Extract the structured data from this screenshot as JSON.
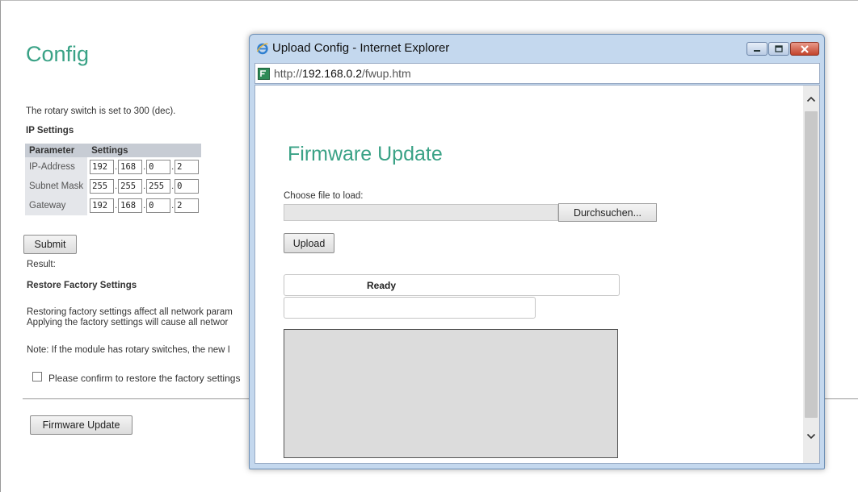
{
  "page": {
    "title": "Config",
    "rotary_text": "The rotary switch is set to 300 (dec).",
    "ip_settings_heading": "IP Settings",
    "table": {
      "headers": [
        "Parameter",
        "Settings"
      ],
      "rows": [
        {
          "label": "IP-Address",
          "octets": [
            "192",
            "168",
            "0",
            "2"
          ]
        },
        {
          "label": "Subnet Mask",
          "octets": [
            "255",
            "255",
            "255",
            "0"
          ]
        },
        {
          "label": "Gateway",
          "octets": [
            "192",
            "168",
            "0",
            "2"
          ]
        }
      ]
    },
    "submit_label": "Submit",
    "result_label": "Result:",
    "restore_heading": "Restore Factory Settings",
    "restore_text_1": "Restoring factory settings affect all network param",
    "restore_text_2": "Applying the factory settings will cause all networ",
    "note_text": "Note: If the module has rotary switches, the new I",
    "confirm_label": "Please confirm to restore the factory settings",
    "confirm_checked": false,
    "firmware_button_label": "Firmware Update"
  },
  "popup": {
    "window_title": "Upload Config - Internet Explorer",
    "url_prefix": "http://",
    "url_host": "192.168.0.2",
    "url_path": "/fwup.htm",
    "heading": "Firmware Update",
    "choose_label": "Choose file to load:",
    "browse_label": "Durchsuchen...",
    "upload_label": "Upload",
    "status_text": "Ready",
    "status2_text": ""
  },
  "colors": {
    "accent_green": "#3aa286",
    "window_chrome": "#c4d8ee",
    "close_red": "#c2432b"
  }
}
